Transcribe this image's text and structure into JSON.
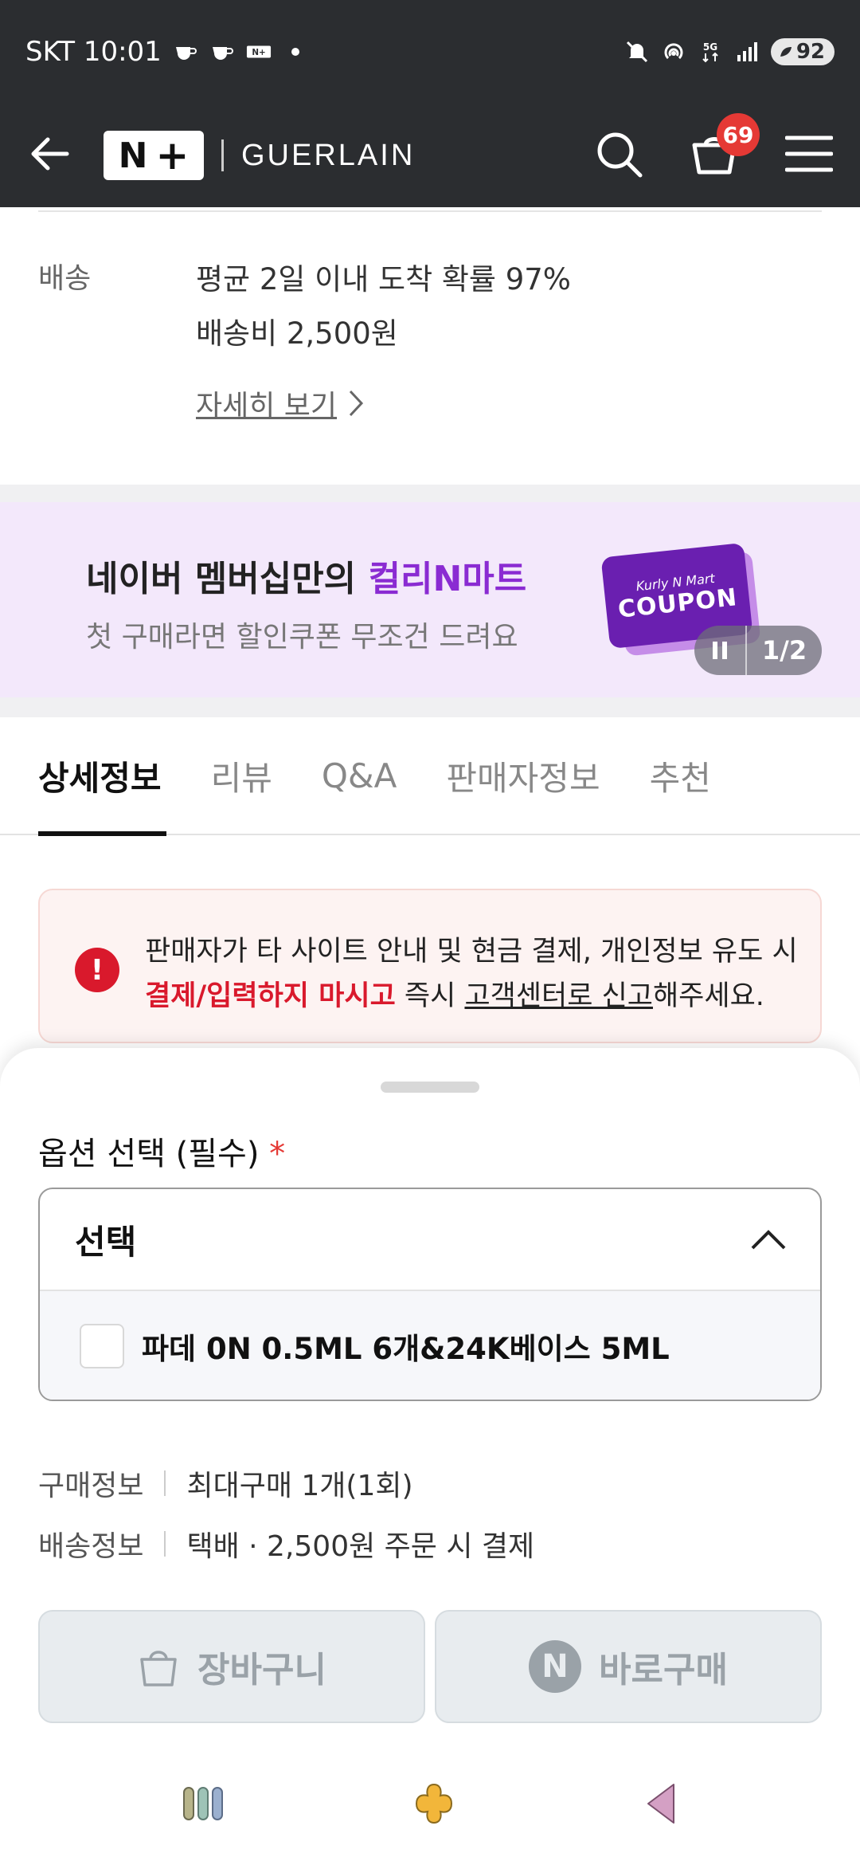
{
  "status_bar": {
    "carrier_time": "SKT 10:01",
    "battery": "92",
    "icons": [
      "coffee-icon",
      "coffee-icon",
      "naver-plus-icon",
      "dot-icon",
      "mute-icon",
      "hotspot-icon",
      "5g-icon",
      "signal-icon",
      "battery-icon"
    ]
  },
  "header": {
    "logo_n": "N",
    "logo_plus": "+",
    "brand": "GUERLAIN",
    "cart_count": "69"
  },
  "delivery": {
    "label": "배송",
    "line1": "평균 2일 이내 도착 확률 97%",
    "line2": "배송비 2,500원",
    "more_link": "자세히 보기"
  },
  "banner": {
    "title_prefix": "네이버 멤버십만의 ",
    "title_accent": "컬리N마트",
    "subtitle": "첫 구매라면 할인쿠폰 무조건 드려요",
    "coupon_small": "Kurly N Mart",
    "coupon_big": "COUPON",
    "pager": "1/2"
  },
  "tabs": [
    "상세정보",
    "리뷰",
    "Q&A",
    "판매자정보",
    "추천"
  ],
  "warning": {
    "line1": "판매자가 타 사이트 안내 및 현금 결제, 개인정보 유도 시",
    "red_part": "결제/입력하지 마시고",
    "mid_part": " 즉시 ",
    "underline_part": "고객센터로 신고",
    "end_part": "해주세요."
  },
  "sheet": {
    "option_title": "옵션 선택 (필수)",
    "required_mark": "*",
    "select_label": "선택",
    "option_item": "파데 0N 0.5ML 6개&24K베이스 5ML",
    "purchase_info_key": "구매정보",
    "purchase_info_val": "최대구매 1개(1회)",
    "shipping_info_key": "배송정보",
    "shipping_info_val": "택배 · 2,500원 주문 시 결제",
    "cart_button": "장바구니",
    "buy_now_n": "N",
    "buy_now_button": "바로구매"
  },
  "colors": {
    "header_bg": "#2b2d30",
    "accent_purple": "#8a2bd2",
    "warning_red": "#d9192c",
    "badge_red": "#e53935"
  }
}
